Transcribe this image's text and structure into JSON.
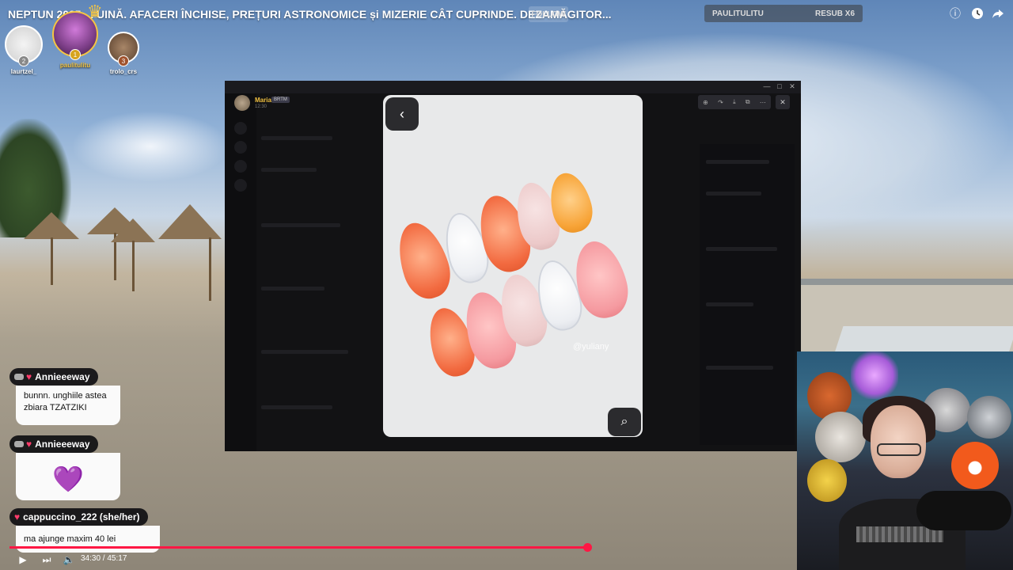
{
  "stream": {
    "title": "NEPTUN 2025 ... UINĂ. AFACERI ÎNCHISE, PREȚURI ASTRONOMICE și MIZERIE CÂT CUPRINDE. DEZAMĂGITOR...",
    "follow_label": "FOLLOW",
    "sub_user": "PAULITULITU",
    "sub_label": "RESUB X6"
  },
  "top_icons": [
    "info-icon",
    "clock-icon",
    "share-icon"
  ],
  "leaderboard": [
    {
      "rank": "2",
      "name": "laurtzel_"
    },
    {
      "rank": "1",
      "name": "paulitulitu"
    },
    {
      "rank": "3",
      "name": "trolo_crs"
    }
  ],
  "discord": {
    "user_name": "Maria",
    "user_badge": "BRTM",
    "user_time": "12:30",
    "watermark": "@yuliany"
  },
  "chat": [
    {
      "user": "Annieeeway",
      "message": "bunnn. unghiile astea zbiara TZATZIKI"
    },
    {
      "user": "Annieeeway",
      "message": "💜"
    },
    {
      "user": "cappuccino_222 (she/her)",
      "message": "ma ajunge maxim 40 lei"
    }
  ],
  "player": {
    "time": "34:30 / 45:17",
    "progress": 0.76
  },
  "colors": {
    "progress": "#ff1744",
    "username_gold": "#f0c040"
  }
}
